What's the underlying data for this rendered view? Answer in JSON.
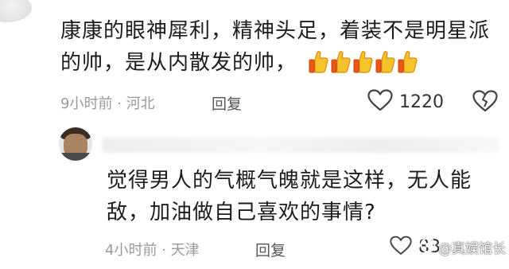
{
  "comments": [
    {
      "lines": [
        "康康的眼神犀利，精神头足，着装不是明星派",
        "的帅，是从内散发的帅，"
      ],
      "emoji": "thumbs-up-icon",
      "emoji_count": 5,
      "time": "9小时前",
      "location": "河北",
      "reply_label": "回复",
      "likes": "1220"
    },
    {
      "lines": [
        "觉得男人的气概气魄就是这样，无人能",
        "敌，加油做自己喜欢的事情?"
      ],
      "time": "4小时前",
      "location": "天津",
      "reply_label": "回复",
      "likes": "83"
    }
  ],
  "meta_separator": "·",
  "watermark": {
    "text": "@真娱馆长"
  },
  "colors": {
    "text": "#1c1c1c",
    "meta": "#9a9a9a",
    "thumb": "#f5c32c"
  }
}
